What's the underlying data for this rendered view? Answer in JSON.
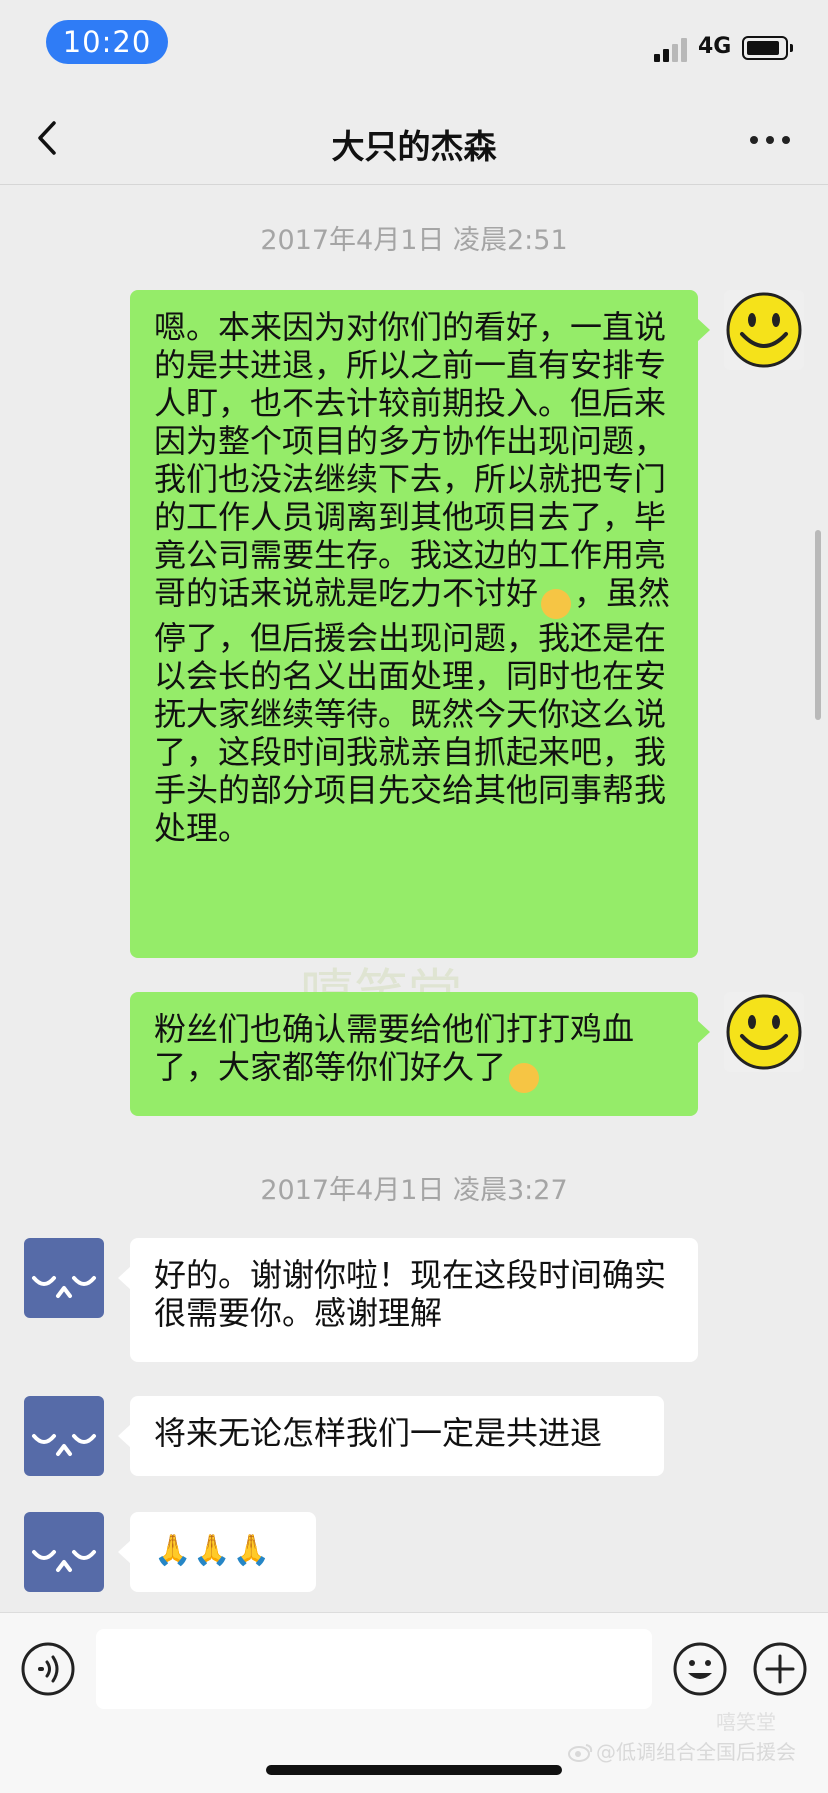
{
  "status_bar": {
    "time": "10:20",
    "network": "4G",
    "battery_icon": "battery-icon",
    "signal_icon": "signal-icon"
  },
  "nav": {
    "title": "大只的杰森",
    "back_icon": "chevron-left-icon",
    "more_icon": "more-dots-icon"
  },
  "messages": {
    "ts1": "2017年4月1日 凌晨2:51",
    "m1_part1": "嗯。本来因为对你们的看好，一直说的是共进退，所以之前一直有安排专人盯，也不去计较前期投入。但后来因为整个项目的多方协作出现问题，我们也没法继续下去，所以就把专门的工作人员调离到其他项目去了，毕竟公司需要生存。我这边的工作用亮哥的话来说就是吃力不讨好",
    "m1_emoji": "🤭",
    "m1_part2": "，虽然停了，但后援会出现问题，我还是在以会长的名义出面处理，同时也在安抚大家继续等待。既然今天你这么说了，这段时间我就亲自抓起来吧，我手头的部分项目先交给其他同事帮我处理。",
    "m2_text": "粉丝们也确认需要给他们打打鸡血了，大家都等你们好久了",
    "m2_emoji": "😊",
    "ts2": "2017年4月1日 凌晨3:27",
    "m3_text": "好的。谢谢你啦！现在这段时间确实很需要你。感谢理解",
    "m4_text": "将来无论怎样我们一定是共进退",
    "m5_text": "🙏🙏🙏"
  },
  "input": {
    "placeholder": "",
    "voice_icon": "voice-icon",
    "emoji_icon": "emoji-icon",
    "plus_icon": "plus-icon"
  },
  "watermark": {
    "weibo": "@低调组合全国后援会",
    "corner": "嘻笑堂"
  },
  "colors": {
    "sent_bubble": "#95ec69",
    "received_bubble": "#ffffff",
    "background": "#ededed",
    "time_pill": "#2f7cf6",
    "avatar_them": "#566ba8"
  }
}
